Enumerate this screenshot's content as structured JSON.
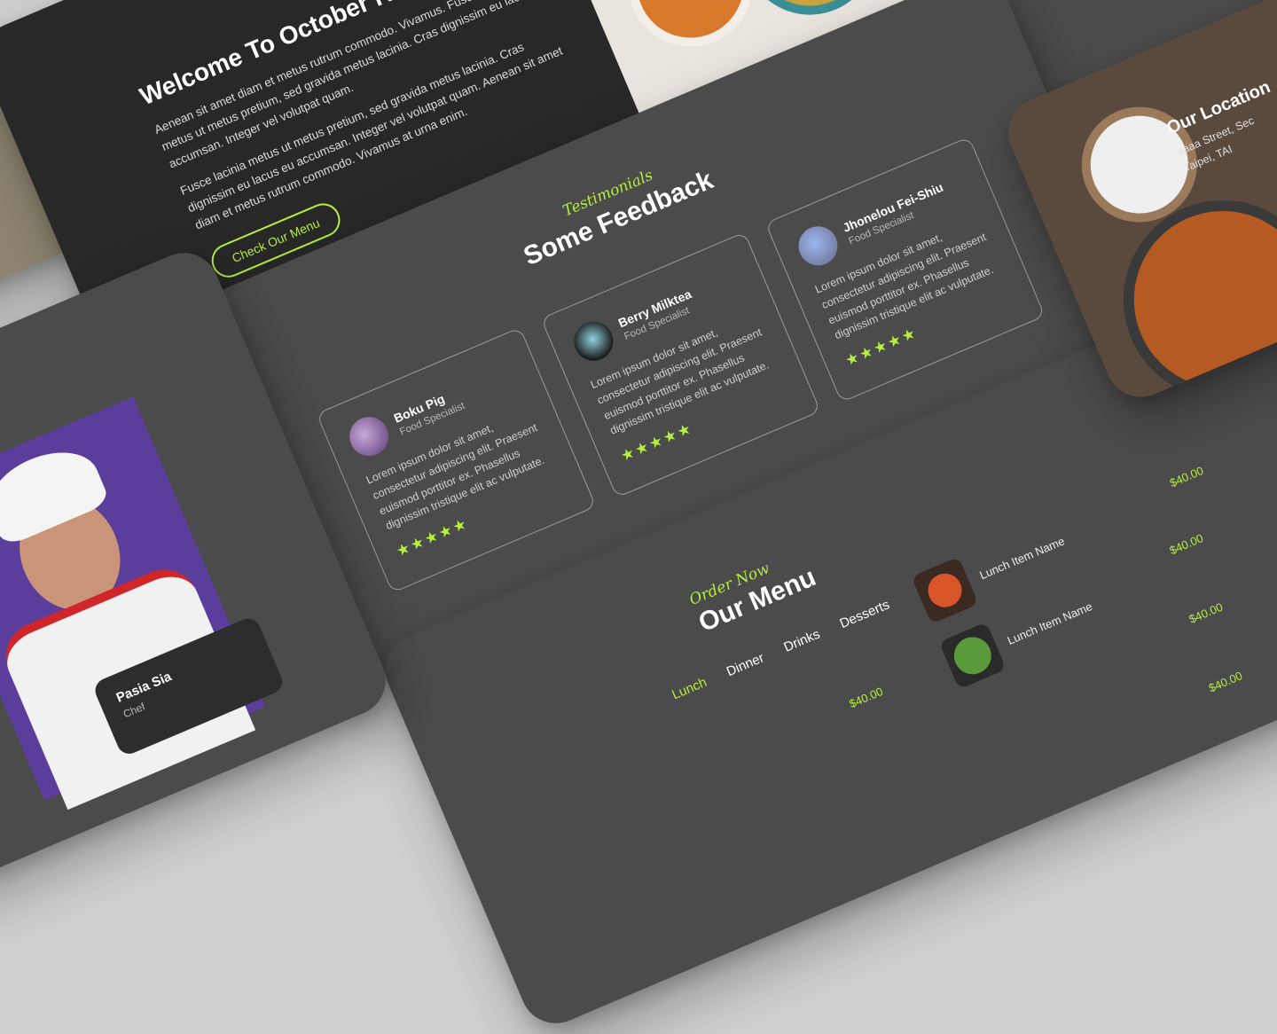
{
  "welcome": {
    "title": "Welcome To October Restaurant",
    "paragraph1": "Aenean sit amet diam et metus rutrum commodo. Vivamus. Fusce lacinia metus ut metus pretium, sed gravida metus lacinia. Cras dignissim eu lacus eu accumsan. Integer vel volutpat quam.",
    "paragraph2": "Fusce lacinia metus ut metus pretium, sed gravida metus lacinia. Cras dignissim eu lacus eu accumsan. Integer vel volutpat quam. Aenean sit amet diam et metus rutrum commodo. Vivamus at urna enim.",
    "button_label": "Check Our Menu"
  },
  "testimonials": {
    "kicker": "Testimonials",
    "title": "Some Feedback",
    "items": [
      {
        "name": "Boku Pig",
        "role": "Food Specialist",
        "text": "Lorem ipsum dolor sit amet, consectetur adipiscing elit. Praesent euismod porttitor ex. Phasellus dignissim tristique elit ac vulputate.",
        "stars": "★★★★★",
        "rating": 5
      },
      {
        "name": "Berry Milktea",
        "role": "Food Specialist",
        "text": "Lorem ipsum dolor sit amet, consectetur adipiscing elit. Praesent euismod porttitor ex. Phasellus dignissim tristique elit ac vulputate.",
        "stars": "★★★★★",
        "rating": 5
      },
      {
        "name": "Jhonelou Fei-Shiu",
        "role": "Food Specialist",
        "text": "Lorem ipsum dolor sit amet, consectetur adipiscing elit. Praesent euismod porttitor ex. Phasellus dignissim tristique elit ac vulputate.",
        "stars": "★★★★★",
        "rating": 5
      }
    ]
  },
  "menu": {
    "kicker": "Order Now",
    "title": "Our Menu",
    "tabs": [
      "Lunch",
      "Dinner",
      "Drinks",
      "Desserts"
    ],
    "active_tab": "Lunch",
    "items": [
      {
        "name": "Lunch Item Name",
        "price": "$40.00"
      },
      {
        "name": "Lunch Item Name",
        "price": "$40.00"
      }
    ],
    "prices_right": [
      "$40.00",
      "$40.00",
      "$40.00",
      "$40.00"
    ]
  },
  "location": {
    "title": "Our Location",
    "line1": "aaaa Street, Sec",
    "line2": "Taipei, TAI"
  },
  "chef": {
    "name": "Pasia Sia",
    "role": "Chef"
  },
  "colors": {
    "accent": "#b4f03c",
    "card_dark": "#282828",
    "card_mid": "#4b4b4b",
    "background": "#cfcfcf"
  },
  "icons": [
    "star-icon"
  ]
}
